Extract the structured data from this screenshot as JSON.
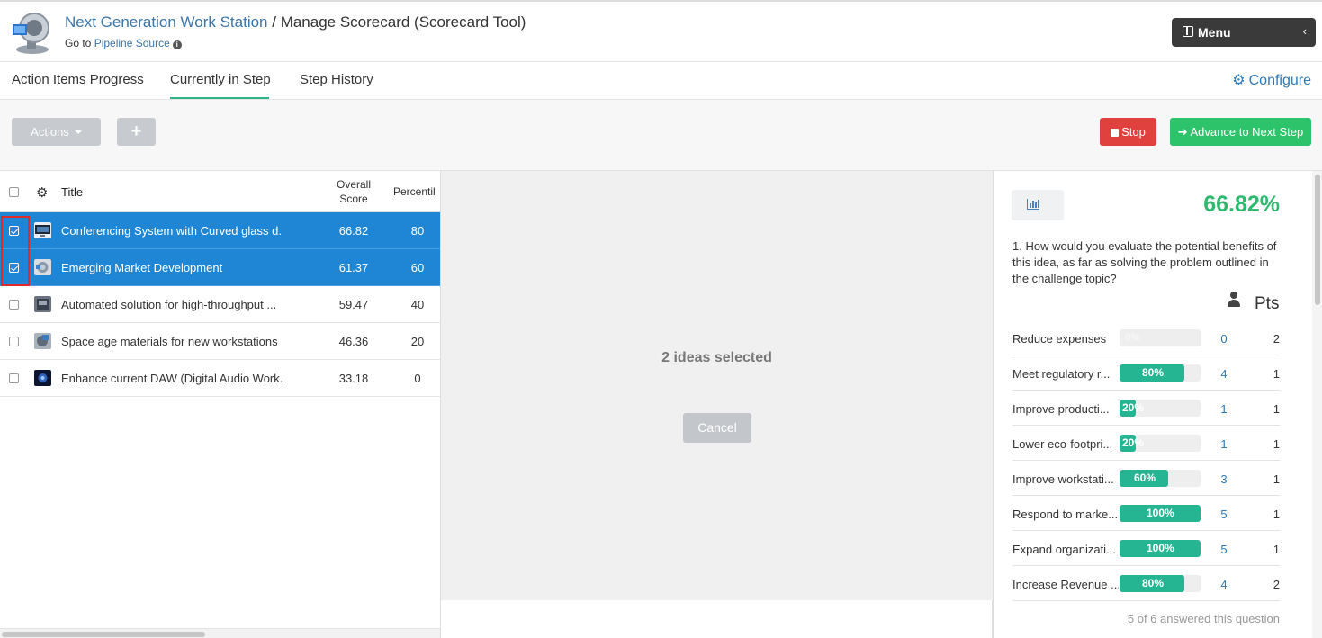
{
  "header": {
    "app_name": "Next Generation Work Station",
    "separator": " / ",
    "page_title": "Manage Scorecard (Scorecard Tool)",
    "goto_prefix": "Go to ",
    "goto_link": "Pipeline Source",
    "menu_label": "Menu",
    "menu_chevron": "‹"
  },
  "tabs": [
    {
      "label": "Action Items Progress"
    },
    {
      "label": "Currently in Step",
      "active": true
    },
    {
      "label": "Step History"
    }
  ],
  "configure_label": "Configure",
  "toolbar": {
    "actions_label": "Actions",
    "add_label": "+",
    "stop_label": "Stop",
    "advance_label": "Advance to Next Step"
  },
  "colors": {
    "accent_blue": "#1f86d5",
    "link_blue": "#3c74a8",
    "stop_red": "#e0403e",
    "advance_green": "#2cc36b",
    "score_green": "#2fb86f",
    "bar_teal": "#26b592",
    "tab_underline": "#2fb48a"
  },
  "list": {
    "columns": {
      "title": "Title",
      "score_line1": "Overall",
      "score_line2": "Score",
      "percentile": "Percentil"
    },
    "rows": [
      {
        "title": "Conferencing System with Curved glass d...",
        "score": "66.82",
        "percentile": "80",
        "selected": true,
        "thumb": "monitor-thumbnail"
      },
      {
        "title": "Emerging Market Development",
        "score": "61.37",
        "percentile": "60",
        "selected": true,
        "thumb": "globe-thumbnail"
      },
      {
        "title": "Automated solution for high-throughput ...",
        "score": "59.47",
        "percentile": "40",
        "selected": false,
        "thumb": "device-thumbnail"
      },
      {
        "title": "Space age materials for new workstations",
        "score": "46.36",
        "percentile": "20",
        "selected": false,
        "thumb": "materials-thumbnail"
      },
      {
        "title": "Enhance current DAW (Digital Audio Work...",
        "score": "33.18",
        "percentile": "0",
        "selected": false,
        "thumb": "audio-thumbnail"
      }
    ]
  },
  "middle": {
    "selected_text": "2 ideas selected",
    "cancel_label": "Cancel"
  },
  "scorecard": {
    "overall": "66.82%",
    "question": "1. How would you evaluate the potential benefits of this idea, as far as solving the problem outlined in the challenge topic?",
    "pts_header": "Pts",
    "answers": [
      {
        "label": "Reduce expenses",
        "percent": 0,
        "percent_label": "0%",
        "count": "0",
        "pts": "2"
      },
      {
        "label": "Meet regulatory r...",
        "percent": 80,
        "percent_label": "80%",
        "count": "4",
        "pts": "1"
      },
      {
        "label": "Improve producti...",
        "percent": 20,
        "percent_label": "20%",
        "count": "1",
        "pts": "1"
      },
      {
        "label": "Lower eco-footpri...",
        "percent": 20,
        "percent_label": "20%",
        "count": "1",
        "pts": "1"
      },
      {
        "label": "Improve workstati...",
        "percent": 60,
        "percent_label": "60%",
        "count": "3",
        "pts": "1"
      },
      {
        "label": "Respond to marke...",
        "percent": 100,
        "percent_label": "100%",
        "count": "5",
        "pts": "1"
      },
      {
        "label": "Expand organizati...",
        "percent": 100,
        "percent_label": "100%",
        "count": "5",
        "pts": "1"
      },
      {
        "label": "Increase Revenue ...",
        "percent": 80,
        "percent_label": "80%",
        "count": "4",
        "pts": "2"
      }
    ],
    "answered_text": "5 of 6 answered this question"
  }
}
